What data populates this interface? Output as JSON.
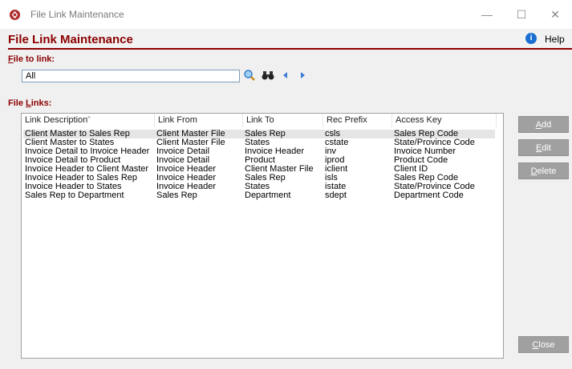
{
  "window": {
    "title": "File Link Maintenance",
    "minimize_glyph": "—",
    "maximize_glyph": "☐",
    "close_glyph": "✕"
  },
  "header": {
    "title": "File Link Maintenance",
    "help_label": "Help"
  },
  "file_to_link": {
    "label_accel": "F",
    "label_rest": "ile to link:",
    "value": "All"
  },
  "file_links": {
    "label_prefix": "File ",
    "label_accel": "L",
    "label_rest": "inks:",
    "columns": [
      "Link Description",
      "Link From",
      "Link To",
      "Rec Prefix",
      "Access Key"
    ],
    "rows": [
      [
        "Client Master to Sales Rep",
        "Client Master File",
        "Sales Rep",
        "csls",
        "Sales Rep Code"
      ],
      [
        "Client Master to States",
        "Client Master File",
        "States",
        "cstate",
        "State/Province Code"
      ],
      [
        "Invoice Detail to Invoice Header",
        "Invoice Detail",
        "Invoice Header",
        "inv",
        "Invoice Number"
      ],
      [
        "Invoice Detail to Product",
        "Invoice Detail",
        "Product",
        "iprod",
        "Product Code"
      ],
      [
        "Invoice Header to Client Master",
        "Invoice Header",
        "Client Master File",
        "iclient",
        "Client ID"
      ],
      [
        "Invoice Header to Sales Rep",
        "Invoice Header",
        "Sales Rep",
        "isls",
        "Sales Rep Code"
      ],
      [
        "Invoice Header to States",
        "Invoice Header",
        "States",
        "istate",
        "State/Province Code"
      ],
      [
        "Sales Rep to Department",
        "Sales Rep",
        "Department",
        "sdept",
        "Department Code"
      ]
    ]
  },
  "buttons": {
    "add": {
      "accel": "A",
      "rest": "dd"
    },
    "edit": {
      "accel": "E",
      "rest": "dit"
    },
    "delete": {
      "accel": "D",
      "rest": "elete"
    },
    "close": {
      "accel": "C",
      "rest": "lose"
    }
  },
  "colors": {
    "accent": "#8b0000",
    "button_disabled": "#a0a0a0",
    "help_blue": "#1a6fd1"
  },
  "icons": [
    "app-logo-icon",
    "search-magnifier-icon",
    "binoculars-icon",
    "previous-arrow-icon",
    "next-arrow-icon",
    "info-icon"
  ]
}
